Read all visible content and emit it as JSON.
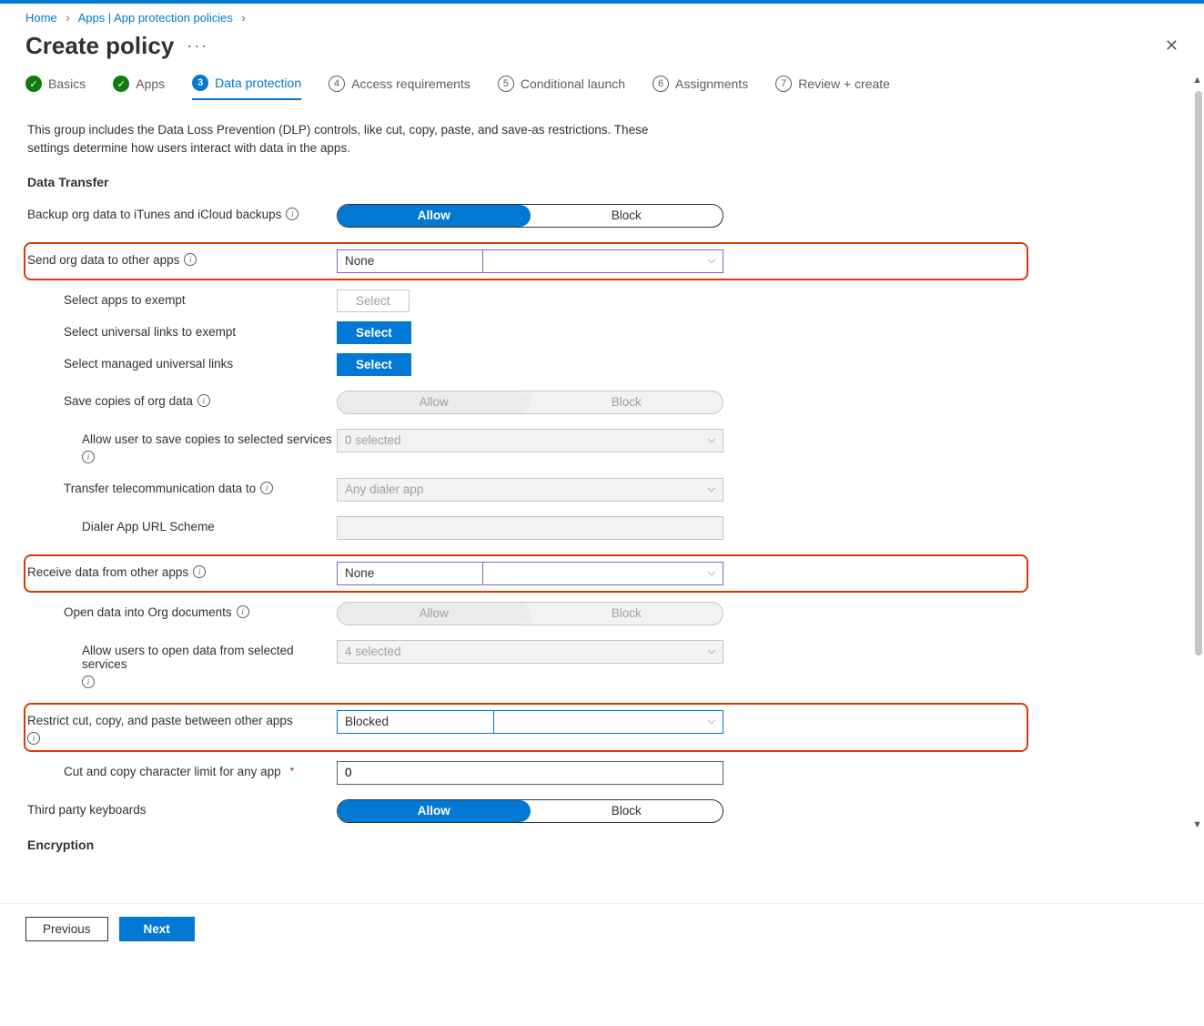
{
  "breadcrumb": {
    "home": "Home",
    "apps": "Apps | App protection policies"
  },
  "header": {
    "title": "Create policy"
  },
  "steps": {
    "s1": "Basics",
    "s2": "Apps",
    "s3": "Data protection",
    "s3_num": "3",
    "s4": "Access requirements",
    "s4_num": "4",
    "s5": "Conditional launch",
    "s5_num": "5",
    "s6": "Assignments",
    "s6_num": "6",
    "s7": "Review + create",
    "s7_num": "7"
  },
  "desc": "This group includes the Data Loss Prevention (DLP) controls, like cut, copy, paste, and save-as restrictions. These settings determine how users interact with data in the apps.",
  "sections": {
    "data_transfer": "Data Transfer",
    "encryption": "Encryption"
  },
  "labels": {
    "allow": "Allow",
    "block": "Block",
    "select": "Select",
    "backup": "Backup org data to iTunes and iCloud backups",
    "send_org": "Send org data to other apps",
    "select_exempt": "Select apps to exempt",
    "select_universal": "Select universal links to exempt",
    "select_managed": "Select managed universal links",
    "save_copies": "Save copies of org data",
    "allow_save_copies": "Allow user to save copies to selected services",
    "transfer_telecom": "Transfer telecommunication data to",
    "dialer_scheme": "Dialer App URL Scheme",
    "receive_data": "Receive data from other apps",
    "open_into_org": "Open data into Org documents",
    "allow_open_from": "Allow users to open data from selected services",
    "restrict_ccp": "Restrict cut, copy, and paste between other apps",
    "ccp_limit": "Cut and copy character limit for any app",
    "third_party_kb": "Third party keyboards"
  },
  "values": {
    "send_org": "None",
    "save_copies_services": "0 selected",
    "transfer_telecom": "Any dialer app",
    "receive_data": "None",
    "open_from_services": "4 selected",
    "restrict_ccp": "Blocked",
    "ccp_limit": "0"
  },
  "footer": {
    "previous": "Previous",
    "next": "Next"
  }
}
